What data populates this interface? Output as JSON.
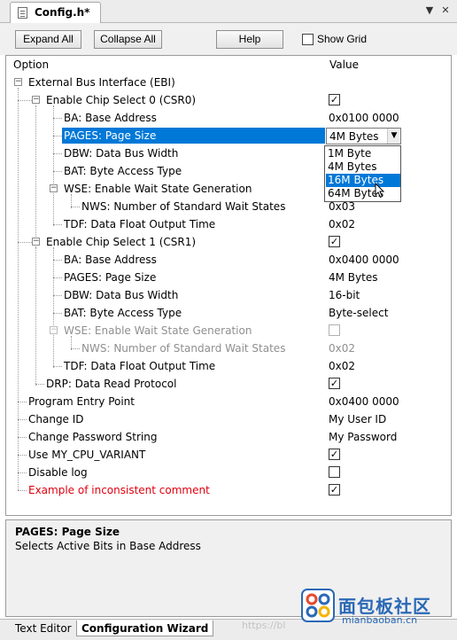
{
  "tab": {
    "title": "Config.h*"
  },
  "toolbar": {
    "expand_all": "Expand All",
    "collapse_all": "Collapse All",
    "help": "Help",
    "show_grid": "Show Grid"
  },
  "columns": {
    "option": "Option",
    "value": "Value"
  },
  "rows": [
    {
      "label": "External Bus Interface (EBI)",
      "value": ""
    },
    {
      "label": "Enable Chip Select 0 (CSR0)",
      "value": ""
    },
    {
      "label": "BA: Base Address",
      "value": "0x0100 0000"
    },
    {
      "label": "PAGES: Page Size",
      "value": "4M Bytes"
    },
    {
      "label": "DBW: Data Bus Width",
      "value": ""
    },
    {
      "label": "BAT: Byte Access Type",
      "value": ""
    },
    {
      "label": "WSE: Enable Wait State Generation",
      "value": ""
    },
    {
      "label": "NWS: Number of Standard Wait States",
      "value": "0x03"
    },
    {
      "label": "TDF: Data Float Output Time",
      "value": "0x02"
    },
    {
      "label": "Enable Chip Select 1 (CSR1)",
      "value": ""
    },
    {
      "label": "BA: Base Address",
      "value": "0x0400 0000"
    },
    {
      "label": "PAGES: Page Size",
      "value": "4M Bytes"
    },
    {
      "label": "DBW: Data Bus Width",
      "value": "16-bit"
    },
    {
      "label": "BAT: Byte Access Type",
      "value": "Byte-select"
    },
    {
      "label": "WSE: Enable Wait State Generation",
      "value": ""
    },
    {
      "label": "NWS: Number of Standard Wait States",
      "value": "0x02"
    },
    {
      "label": "TDF: Data Float Output Time",
      "value": "0x02"
    },
    {
      "label": "DRP: Data Read Protocol",
      "value": ""
    },
    {
      "label": "Program Entry Point",
      "value": "0x0400 0000"
    },
    {
      "label": "Change ID",
      "value": "My User ID"
    },
    {
      "label": "Change Password String",
      "value": "My Password"
    },
    {
      "label": "Use MY_CPU_VARIANT",
      "value": ""
    },
    {
      "label": "Disable log",
      "value": ""
    },
    {
      "label": "Example of inconsistent comment",
      "value": ""
    }
  ],
  "checkboxes": {
    "csr0_enabled": "✓",
    "csr1_enabled": "✓",
    "drp": "✓",
    "use_cpu_variant": "✓",
    "disable_log": "",
    "inconsistent": "✓"
  },
  "dropdown_options": [
    "1M Byte",
    "4M Bytes",
    "16M Bytes",
    "64M Bytes"
  ],
  "description": {
    "title": "PAGES: Page Size",
    "text": "Selects Active Bits in Base Address"
  },
  "bottom_tabs": {
    "text_editor": "Text Editor",
    "config_wizard": "Configuration Wizard"
  },
  "watermark": {
    "cn": "面包板社区",
    "en": "mianbaoban.cn",
    "faint": "https://bl"
  },
  "colors": {
    "selection": "#0078d7",
    "warning_text": "#e0000e",
    "disabled_text": "#8f8f8f"
  }
}
